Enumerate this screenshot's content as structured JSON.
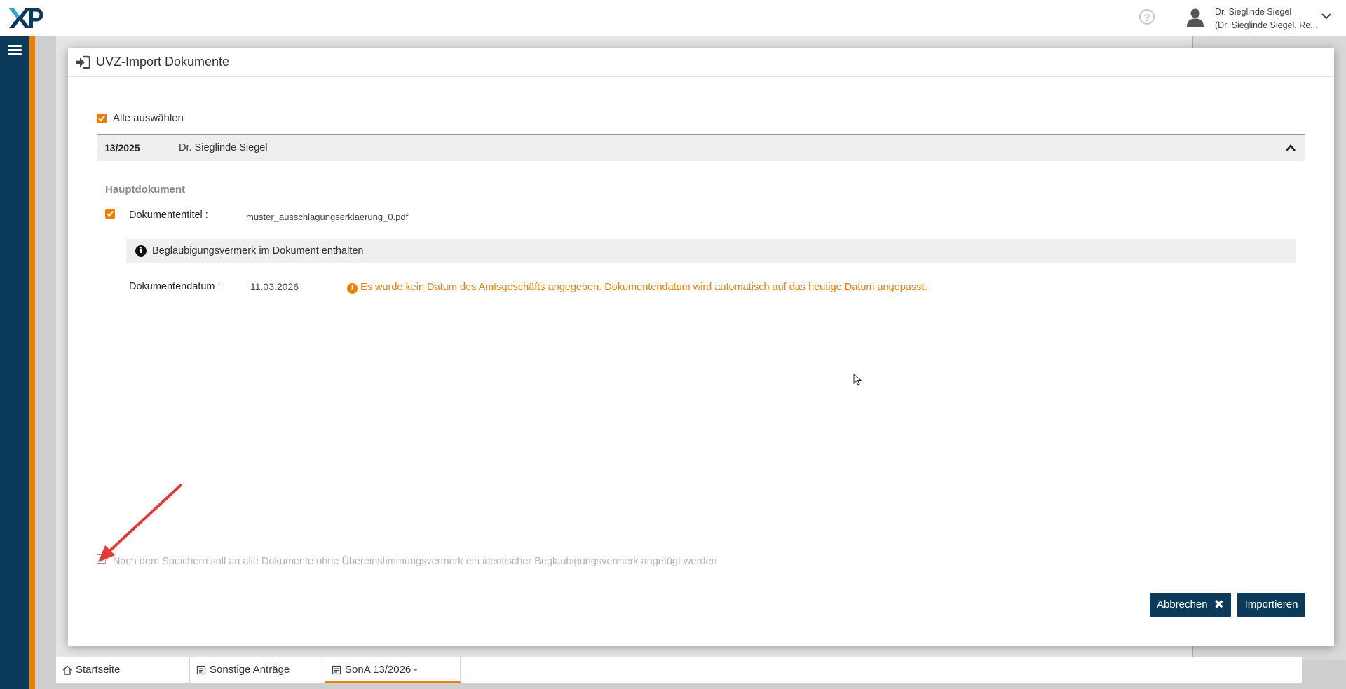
{
  "header": {
    "logo_text": "XP",
    "help_icon": "help-circle-icon",
    "user": {
      "name": "Dr. Sieglinde Siegel",
      "role": "(Dr. Sieglinde Siegel, Re..."
    }
  },
  "dialog": {
    "title": "UVZ-Import Dokumente",
    "select_all": {
      "label": "Alle auswählen",
      "checked": true
    },
    "group": {
      "number": "13/2025",
      "name": "Dr. Sieglinde Siegel",
      "expanded": true
    },
    "section_label": "Hauptdokument",
    "document": {
      "checked": true,
      "title_label": "Dokumententitel :",
      "title_value": "muster_ausschlagungserklaerung_0.pdf",
      "info_text": "Beglaubigungsvermerk im Dokument enthalten",
      "date_label": "Dokumentendatum :",
      "date_value": "11.03.2026",
      "warning_text": "Es wurde kein Datum des Amtsgeschäfts angegeben. Dokumentendatum wird automatisch auf das heutige Datum angepasst."
    },
    "footer_checkbox": {
      "label": "Nach dem Speichern soll an alle Dokumente ohne Übereinstimmungsvermerk ein identischer Beglaubigungsvermerk angefügt werden",
      "checked": false,
      "disabled": true
    },
    "buttons": {
      "cancel": "Abbrechen",
      "import": "Importieren"
    }
  },
  "tabs": [
    {
      "label": "Startseite",
      "icon": "home-icon"
    },
    {
      "label": "Sonstige Anträge",
      "icon": "document-icon"
    },
    {
      "label": "SonA 13/2026 -",
      "icon": "document-icon",
      "active": true
    }
  ],
  "colors": {
    "nav": "#0c3a5b",
    "accent": "#ef7d00",
    "button": "#0c3a5b"
  }
}
